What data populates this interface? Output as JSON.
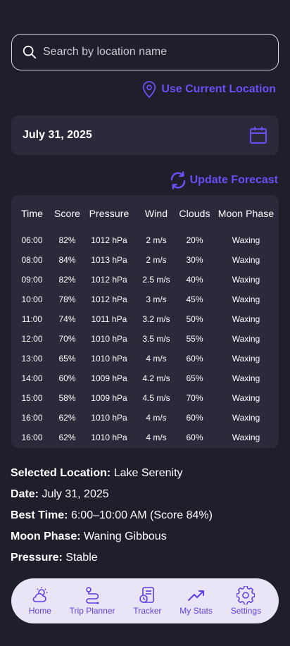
{
  "search": {
    "placeholder": "Search by location name"
  },
  "location_button": {
    "label": "Use Current Location"
  },
  "date_field": {
    "value": "July 31, 2025"
  },
  "update_button": {
    "label": "Update Forecast"
  },
  "table": {
    "headers": [
      "Time",
      "Score",
      "Pressure",
      "Wind",
      "Clouds",
      "Moon Phase"
    ],
    "rows": [
      [
        "06:00",
        "82%",
        "1012 hPa",
        "2 m/s",
        "20%",
        "Waxing"
      ],
      [
        "08:00",
        "84%",
        "1013 hPa",
        "2 m/s",
        "30%",
        "Waxing"
      ],
      [
        "09:00",
        "82%",
        "1012 hPa",
        "2.5 m/s",
        "40%",
        "Waxing"
      ],
      [
        "10:00",
        "78%",
        "1012 hPa",
        "3 m/s",
        "45%",
        "Waxing"
      ],
      [
        "11:00",
        "74%",
        "1011 hPa",
        "3.2 m/s",
        "50%",
        "Waxing"
      ],
      [
        "12:00",
        "70%",
        "1010 hPa",
        "3.5 m/s",
        "55%",
        "Waxing"
      ],
      [
        "13:00",
        "65%",
        "1010 hPa",
        "4 m/s",
        "60%",
        "Waxing"
      ],
      [
        "14:00",
        "60%",
        "1009 hPa",
        "4.2 m/s",
        "65%",
        "Waxing"
      ],
      [
        "15:00",
        "58%",
        "1009 hPa",
        "4.5 m/s",
        "70%",
        "Waxing"
      ],
      [
        "16:00",
        "62%",
        "1010 hPa",
        "4 m/s",
        "60%",
        "Waxing"
      ],
      [
        "16:00",
        "62%",
        "1010 hPa",
        "4 m/s",
        "60%",
        "Waxing"
      ]
    ]
  },
  "summary": {
    "location_label": "Selected Location:",
    "location_value": " Lake Serenity",
    "date_label": "Date:",
    "date_value": " July 31, 2025",
    "best_label": "Best Time:",
    "best_value": " 6:00–10:00 AM (Score 84%)",
    "moon_label": "Moon Phase:",
    "moon_value": " Waning Gibbous",
    "pressure_label": "Pressure:",
    "pressure_value": " Stable"
  },
  "nav": {
    "items": [
      {
        "label": "Home",
        "icon": "weather-icon"
      },
      {
        "label": "Trip Planner",
        "icon": "route-icon"
      },
      {
        "label": "Tracker",
        "icon": "tracker-icon"
      },
      {
        "label": "My Stats",
        "icon": "trending-up-icon"
      },
      {
        "label": "Settings",
        "icon": "gear-icon"
      }
    ]
  },
  "colors": {
    "background": "#1f1f2b",
    "card": "#2a2a3a",
    "accent": "#6b4ff6",
    "nav_bg": "#eae5f6"
  }
}
